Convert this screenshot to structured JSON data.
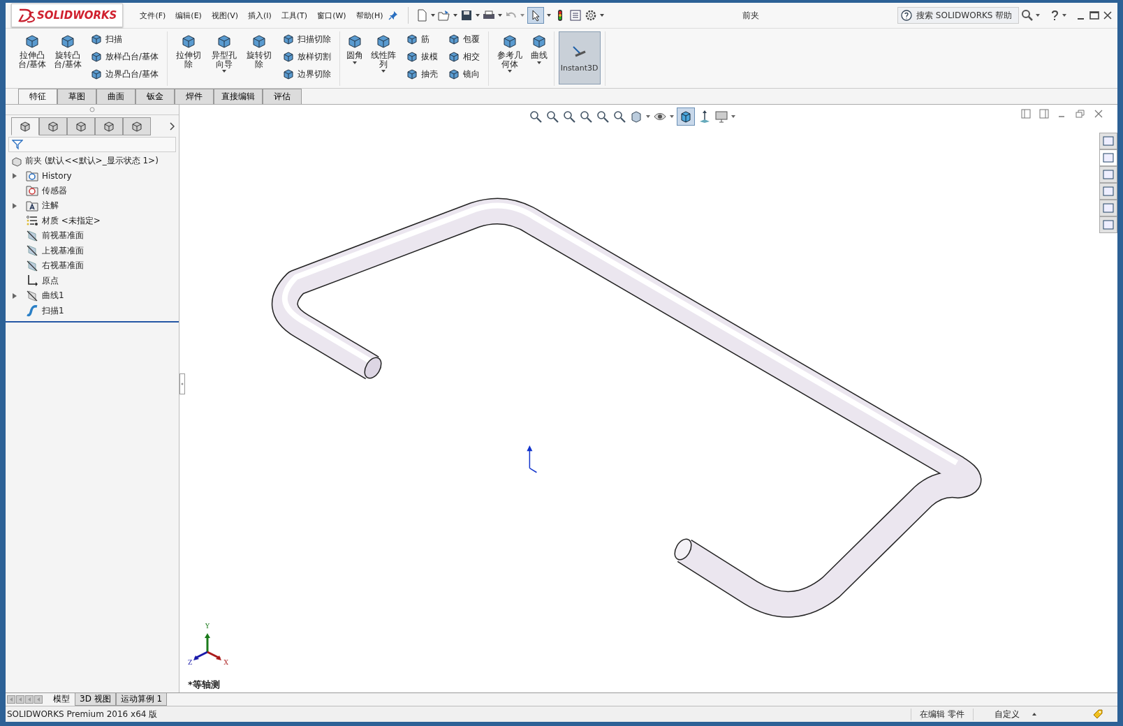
{
  "window": {
    "title": "前夹",
    "logo": "SOLIDWORKS"
  },
  "menus": [
    {
      "label": "文件(F)"
    },
    {
      "label": "编辑(E)"
    },
    {
      "label": "视图(V)"
    },
    {
      "label": "插入(I)"
    },
    {
      "label": "工具(T)"
    },
    {
      "label": "窗口(W)"
    },
    {
      "label": "帮助(H)"
    }
  ],
  "toolbar": {
    "select_pressed": true
  },
  "search": {
    "placeholder": "搜索 SOLIDWORKS 帮助"
  },
  "ribbon": [
    {
      "items": [
        {
          "kind": "large",
          "label": "拉伸凸台/基体",
          "dropdown": false
        },
        {
          "kind": "large",
          "label": "旋转凸台/基体",
          "dropdown": false
        },
        {
          "kind": "stack",
          "labels": [
            "扫描",
            "放样凸台/基体",
            "边界凸台/基体"
          ]
        }
      ]
    },
    {
      "items": [
        {
          "kind": "large",
          "label": "拉伸切除",
          "dropdown": false
        },
        {
          "kind": "large",
          "label": "异型孔向导",
          "dropdown": true
        },
        {
          "kind": "large",
          "label": "旋转切除",
          "dropdown": false
        },
        {
          "kind": "stack",
          "labels": [
            "扫描切除",
            "放样切割",
            "边界切除"
          ]
        }
      ]
    },
    {
      "items": [
        {
          "kind": "large",
          "label": "圆角",
          "dropdown": true
        },
        {
          "kind": "large",
          "label": "线性阵列",
          "dropdown": true
        },
        {
          "kind": "stack",
          "labels": [
            "筋",
            "拔模",
            "抽壳"
          ]
        },
        {
          "kind": "stack",
          "labels": [
            "包覆",
            "相交",
            "镜向"
          ]
        }
      ]
    },
    {
      "items": [
        {
          "kind": "large",
          "label": "参考几何体",
          "dropdown": true
        },
        {
          "kind": "large",
          "label": "曲线",
          "dropdown": true
        }
      ]
    },
    {
      "items": [
        {
          "kind": "toggle",
          "label": "Instant3D",
          "selected": true
        }
      ]
    }
  ],
  "command_tabs": [
    {
      "label": "特征",
      "selected": true
    },
    {
      "label": "草图",
      "selected": false
    },
    {
      "label": "曲面",
      "selected": false
    },
    {
      "label": "钣金",
      "selected": false
    },
    {
      "label": "焊件",
      "selected": false
    },
    {
      "label": "直接编辑",
      "selected": false
    },
    {
      "label": "评估",
      "selected": false
    }
  ],
  "view_toolbar": {
    "shaded_pressed": true
  },
  "panel_tabs": [
    {
      "selected": true
    },
    {
      "selected": false
    },
    {
      "selected": false
    },
    {
      "selected": false
    },
    {
      "selected": false
    }
  ],
  "feature_tree": {
    "root": "前夹  (默认<<默认>_显示状态 1>)",
    "items": [
      {
        "kind": "history",
        "label": "History",
        "has_children": true
      },
      {
        "kind": "sensor",
        "label": "传感器",
        "has_children": false
      },
      {
        "kind": "annotation",
        "label": "注解",
        "has_children": true
      },
      {
        "kind": "material",
        "label": "材质 <未指定>",
        "has_children": false
      },
      {
        "kind": "plane",
        "label": "前视基准面",
        "has_children": false
      },
      {
        "kind": "plane",
        "label": "上视基准面",
        "has_children": false
      },
      {
        "kind": "plane",
        "label": "右视基准面",
        "has_children": false
      },
      {
        "kind": "origin",
        "label": "原点",
        "has_children": false
      },
      {
        "kind": "curve",
        "label": "曲线1",
        "has_children": true
      },
      {
        "kind": "sweep",
        "label": "扫描1",
        "has_children": false
      }
    ]
  },
  "viewport": {
    "view_name": "*等轴测",
    "triad": {
      "x": "X",
      "y": "Y",
      "z": "Z"
    }
  },
  "task_pane_tabs": [
    {
      "selected": false
    },
    {
      "selected": true
    },
    {
      "selected": false
    },
    {
      "selected": false
    },
    {
      "selected": false
    },
    {
      "selected": false
    }
  ],
  "bottom_tabs": [
    {
      "label": "模型",
      "selected": true
    },
    {
      "label": "3D 视图",
      "selected": false
    },
    {
      "label": "运动算例 1",
      "selected": false
    }
  ],
  "status_bar": {
    "product": "SOLIDWORKS Premium 2016 x64 版",
    "mode": "在编辑 零件",
    "units": "自定义"
  }
}
